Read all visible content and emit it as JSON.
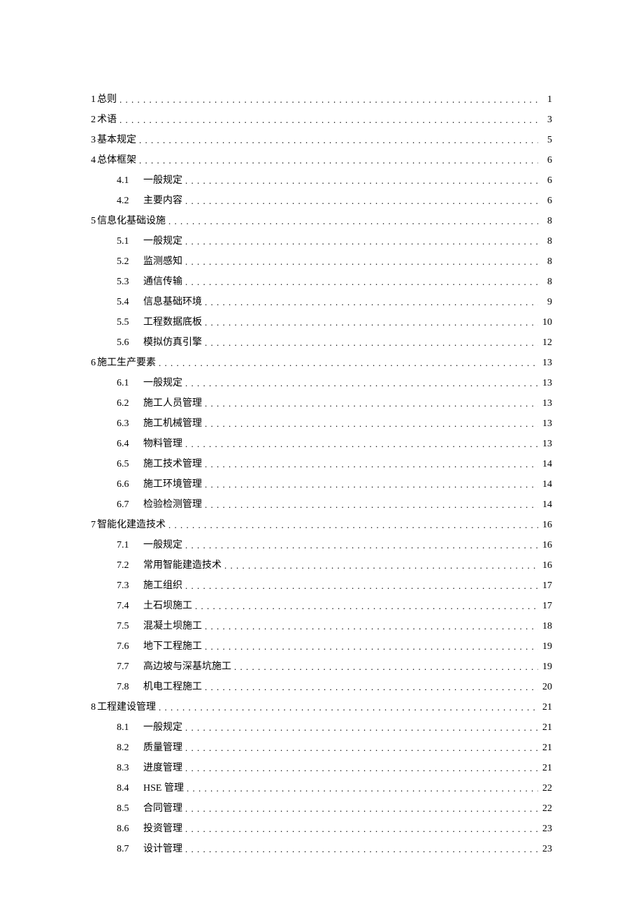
{
  "toc": [
    {
      "level": 1,
      "num": "1",
      "title": "总则",
      "page": "1"
    },
    {
      "level": 1,
      "num": "2",
      "title": "术语",
      "page": "3"
    },
    {
      "level": 1,
      "num": "3",
      "title": "基本规定",
      "page": "5"
    },
    {
      "level": 1,
      "num": "4",
      "title": "总体框架",
      "page": "6"
    },
    {
      "level": 2,
      "num": "4.1",
      "title": "一般规定",
      "page": "6"
    },
    {
      "level": 2,
      "num": "4.2",
      "title": "主要内容",
      "page": "6"
    },
    {
      "level": 1,
      "num": "5",
      "title": "信息化基础设施",
      "page": "8"
    },
    {
      "level": 2,
      "num": "5.1",
      "title": "一般规定",
      "page": "8"
    },
    {
      "level": 2,
      "num": "5.2",
      "title": "监测感知",
      "page": "8"
    },
    {
      "level": 2,
      "num": "5.3",
      "title": "通信传输",
      "page": "8"
    },
    {
      "level": 2,
      "num": "5.4",
      "title": "信息基础环境",
      "page": "9"
    },
    {
      "level": 2,
      "num": "5.5",
      "title": "工程数据底板",
      "page": "10"
    },
    {
      "level": 2,
      "num": "5.6",
      "title": "模拟仿真引擎",
      "page": "12"
    },
    {
      "level": 1,
      "num": "6",
      "title": "施工生产要素",
      "page": "13"
    },
    {
      "level": 2,
      "num": "6.1",
      "title": "一般规定",
      "page": "13"
    },
    {
      "level": 2,
      "num": "6.2",
      "title": "施工人员管理",
      "page": "13"
    },
    {
      "level": 2,
      "num": "6.3",
      "title": "施工机械管理",
      "page": "13"
    },
    {
      "level": 2,
      "num": "6.4",
      "title": "物料管理",
      "page": "13"
    },
    {
      "level": 2,
      "num": "6.5",
      "title": "施工技术管理",
      "page": "14"
    },
    {
      "level": 2,
      "num": "6.6",
      "title": "施工环境管理",
      "page": "14"
    },
    {
      "level": 2,
      "num": "6.7",
      "title": "检验检测管理",
      "page": "14"
    },
    {
      "level": 1,
      "num": "7",
      "title": "智能化建造技术",
      "page": "16"
    },
    {
      "level": 2,
      "num": "7.1",
      "title": "一般规定",
      "page": "16"
    },
    {
      "level": 2,
      "num": "7.2",
      "title": "常用智能建造技术",
      "page": "16"
    },
    {
      "level": 2,
      "num": "7.3",
      "title": "施工组织",
      "page": "17"
    },
    {
      "level": 2,
      "num": "7.4",
      "title": "土石坝施工",
      "page": "17"
    },
    {
      "level": 2,
      "num": "7.5",
      "title": "混凝土坝施工",
      "page": "18"
    },
    {
      "level": 2,
      "num": "7.6",
      "title": "地下工程施工",
      "page": "19"
    },
    {
      "level": 2,
      "num": "7.7",
      "title": "高边坡与深基坑施工",
      "page": "19"
    },
    {
      "level": 2,
      "num": "7.8",
      "title": "机电工程施工",
      "page": "20"
    },
    {
      "level": 1,
      "num": "8",
      "title": "工程建设管理",
      "page": "21"
    },
    {
      "level": 2,
      "num": "8.1",
      "title": "一般规定",
      "page": "21"
    },
    {
      "level": 2,
      "num": "8.2",
      "title": "质量管理",
      "page": "21"
    },
    {
      "level": 2,
      "num": "8.3",
      "title": "进度管理",
      "page": "21"
    },
    {
      "level": 2,
      "num": "8.4",
      "title": "HSE 管理",
      "page": "22"
    },
    {
      "level": 2,
      "num": "8.5",
      "title": "合同管理",
      "page": "22"
    },
    {
      "level": 2,
      "num": "8.6",
      "title": "投资管理",
      "page": "23"
    },
    {
      "level": 2,
      "num": "8.7",
      "title": "设计管理",
      "page": "23"
    }
  ]
}
